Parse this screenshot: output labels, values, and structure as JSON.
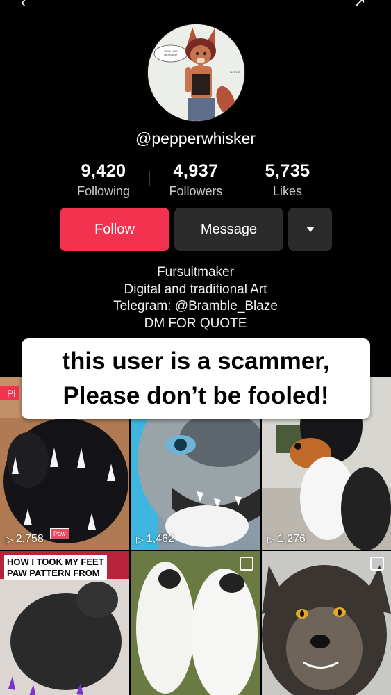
{
  "header": {
    "back_icon": "‹",
    "title": "",
    "share_icon": "share-icon"
  },
  "profile": {
    "username": "@pepperwhisker",
    "avatar": {
      "speech_bubble_text": "WHICH ONE YOU A WEREWOLF ... I'M ... TOOTH",
      "caption": "FLIRTING"
    },
    "stats": [
      {
        "value": "9,420",
        "label": "Following"
      },
      {
        "value": "4,937",
        "label": "Followers"
      },
      {
        "value": "5,735",
        "label": "Likes"
      }
    ],
    "buttons": {
      "follow": "Follow",
      "message": "Message",
      "more_icon": "caret-down-icon"
    },
    "bio": [
      "Fursuitmaker",
      "Digital and traditional Art",
      "Telegram: @Bramble_Blaze",
      "DM FOR QUOTE"
    ]
  },
  "warning": {
    "line1": "this user is a scammer,",
    "line2": "Please don’t be fooled!"
  },
  "grid": {
    "videos": [
      {
        "views": "2,758",
        "badge": "Pi",
        "tag": "Paw"
      },
      {
        "views": "1,462"
      },
      {
        "views": "1,276"
      },
      {
        "title_lines": [
          "HOW I TOOK MY FEET",
          "PAW PATTERN FROM"
        ]
      },
      {
        "multi": true
      },
      {
        "multi": true
      }
    ]
  },
  "colors": {
    "background": "#000000",
    "follow_button": "#f2324f",
    "secondary_button": "#2b2b2b",
    "warning_bg": "#ffffff"
  }
}
